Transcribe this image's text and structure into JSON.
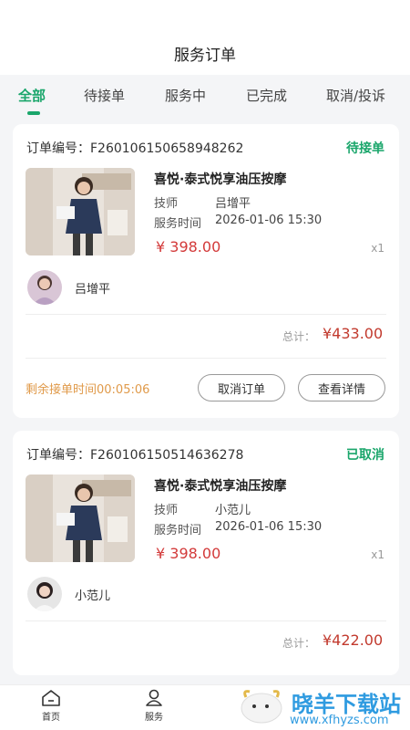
{
  "header": {
    "title": "服务订单"
  },
  "tabs": [
    {
      "label": "全部"
    },
    {
      "label": "待接单"
    },
    {
      "label": "服务中"
    },
    {
      "label": "已完成"
    },
    {
      "label": "取消/投诉"
    }
  ],
  "orders": [
    {
      "order_no": "订单编号：F260106150658948262",
      "status": "待接单",
      "service_name": "喜悦·泰式悦享油压按摩",
      "tech_label": "技师",
      "tech_value": "吕增平",
      "time_label": "服务时间",
      "time_value": "2026-01-06 15:30",
      "price": "¥ 398.00",
      "qty": "x1",
      "technician": "吕增平",
      "total_label": "总计：",
      "total_value": "¥433.00",
      "countdown": "剩余接单时间00:05:06",
      "cancel_label": "取消订单",
      "detail_label": "查看详情"
    },
    {
      "order_no": "订单编号：F260106150514636278",
      "status": "已取消",
      "service_name": "喜悦·泰式悦享油压按摩",
      "tech_label": "技师",
      "tech_value": "小范儿",
      "time_label": "服务时间",
      "time_value": "2026-01-06 15:30",
      "price": "¥ 398.00",
      "qty": "x1",
      "technician": "小范儿",
      "total_label": "总计：",
      "total_value": "¥422.00"
    }
  ],
  "tabbar": [
    {
      "label": "首页",
      "icon": "home-icon"
    },
    {
      "label": "服务",
      "icon": "service-icon"
    }
  ],
  "watermark": {
    "text": "晓羊下载站",
    "url": "www.xfhyzs.com"
  },
  "colors": {
    "accent": "#1aa66b",
    "price": "#d33a3a",
    "countdown": "#e09a4a",
    "watermark": "#2f9be0"
  }
}
